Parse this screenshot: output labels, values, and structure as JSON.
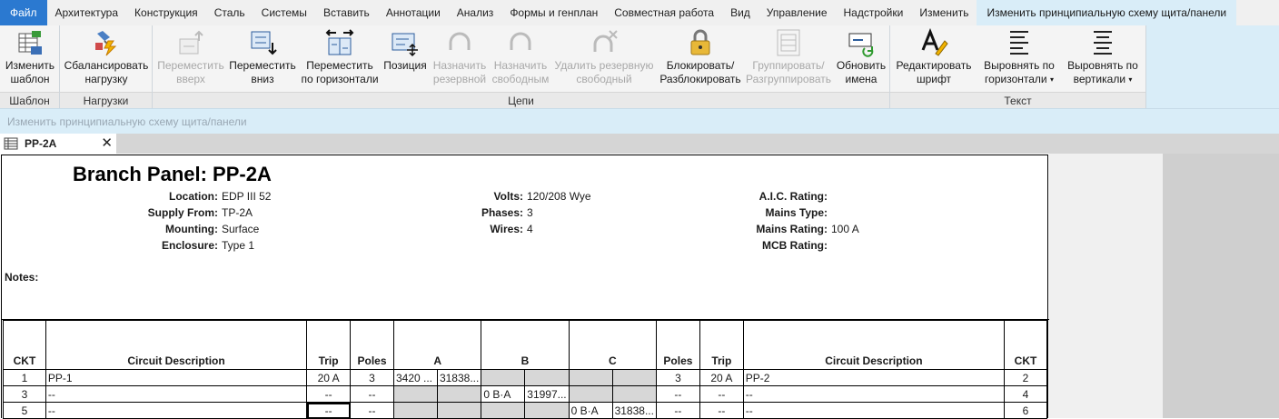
{
  "menu": {
    "items": [
      "Файл",
      "Архитектура",
      "Конструкция",
      "Сталь",
      "Системы",
      "Вставить",
      "Аннотации",
      "Анализ",
      "Формы и генплан",
      "Совместная работа",
      "Вид",
      "Управление",
      "Надстройки",
      "Изменить",
      "Изменить принципиальную схему щита/панели"
    ]
  },
  "ribbon": {
    "panels": {
      "template": "Шаблон",
      "loads": "Нагрузки",
      "circuits": "Цепи",
      "text": "Текст"
    },
    "buttons": {
      "edit_template": [
        "Изменить",
        "шаблон"
      ],
      "balance_loads": [
        "Сбалансировать",
        "нагрузку"
      ],
      "move_up": [
        "Переместить",
        "вверх"
      ],
      "move_down": [
        "Переместить",
        "вниз"
      ],
      "move_across": [
        "Переместить",
        "по горизонтали"
      ],
      "position": [
        "Позиция",
        ""
      ],
      "assign_spare": [
        "Назначить",
        "резервной"
      ],
      "assign_space": [
        "Назначить",
        "свободным"
      ],
      "remove_spare": [
        "Удалить резервную",
        "свободный"
      ],
      "lock_unlock": [
        "Блокировать/",
        "Разблокировать"
      ],
      "group_ungroup": [
        "Группировать/",
        "Разгруппировать"
      ],
      "rename": [
        "Обновить",
        "имена"
      ],
      "edit_font": [
        "Редактировать",
        "шрифт"
      ],
      "align_horizontal": [
        "Выровнять по",
        "горизонтали"
      ],
      "align_vertical": [
        "Выровнять по",
        "вертикали"
      ]
    }
  },
  "options_bar": "Изменить принципиальную схему щита/панели",
  "tab": {
    "name": "PP-2A",
    "close": "✕"
  },
  "panel_schedule": {
    "title": "Branch Panel: PP-2A",
    "fields": {
      "location": {
        "label": "Location:",
        "value": "EDP III 52"
      },
      "supply_from": {
        "label": "Supply From:",
        "value": "TP-2A"
      },
      "mounting": {
        "label": "Mounting:",
        "value": "Surface"
      },
      "enclosure": {
        "label": "Enclosure:",
        "value": "Type 1"
      },
      "volts": {
        "label": "Volts:",
        "value": "120/208 Wye"
      },
      "phases": {
        "label": "Phases:",
        "value": "3"
      },
      "wires": {
        "label": "Wires:",
        "value": "4"
      },
      "aic": {
        "label": "A.I.C. Rating:",
        "value": ""
      },
      "mains_type": {
        "label": "Mains Type:",
        "value": ""
      },
      "mains_rating": {
        "label": "Mains Rating:",
        "value": "100 A"
      },
      "mcb_rating": {
        "label": "MCB Rating:",
        "value": ""
      }
    },
    "notes_label": "Notes:",
    "columns": [
      "CKT",
      "Circuit Description",
      "Trip",
      "Poles",
      "A",
      "B",
      "C",
      "Poles",
      "Trip",
      "Circuit Description",
      "CKT"
    ],
    "rows": [
      {
        "ckt_l": "1",
        "desc_l": "PP-1",
        "trip_l": "20 A",
        "poles_l": "3",
        "a1": "3420 ...",
        "a2": "31838...",
        "b1": "",
        "b2": "",
        "c1": "",
        "c2": "",
        "poles_r": "3",
        "trip_r": "20 A",
        "desc_r": "PP-2",
        "ckt_r": "2"
      },
      {
        "ckt_l": "3",
        "desc_l": "--",
        "trip_l": "--",
        "poles_l": "--",
        "a1": "",
        "a2": "",
        "b1": "0 B·A",
        "b2": "31997...",
        "c1": "",
        "c2": "",
        "poles_r": "--",
        "trip_r": "--",
        "desc_r": "--",
        "ckt_r": "4"
      },
      {
        "ckt_l": "5",
        "desc_l": "--",
        "trip_l": "--",
        "poles_l": "--",
        "a1": "",
        "a2": "",
        "b1": "",
        "b2": "",
        "c1": "0 B·A",
        "c2": "31838...",
        "poles_r": "--",
        "trip_r": "--",
        "desc_r": "--",
        "ckt_r": "6"
      }
    ]
  }
}
